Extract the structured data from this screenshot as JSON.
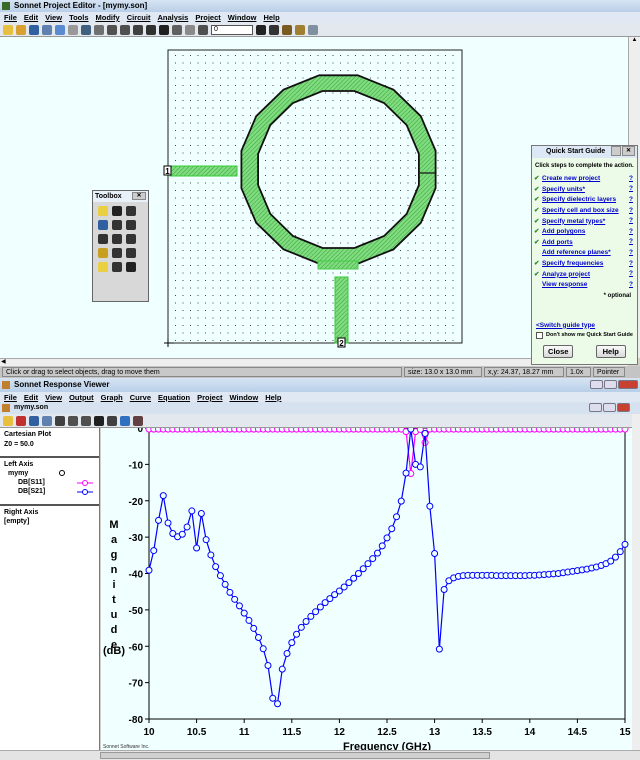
{
  "editor": {
    "title": "Sonnet Project Editor - [mymy.son]",
    "menu": [
      "File",
      "Edit",
      "View",
      "Tools",
      "Modify",
      "Circuit",
      "Analysis",
      "Project",
      "Window",
      "Help"
    ],
    "toolbar_icons": [
      "new-icon",
      "open-icon",
      "save-icon",
      "cut-icon",
      "copy-icon",
      "paste-icon",
      "rotate-icon",
      "box-icon",
      "zoom-in-icon",
      "zoom-out-icon",
      "zoom-fit-icon",
      "pan-icon",
      "center-icon",
      "eraser-icon",
      "layer-icon",
      "level-icon"
    ],
    "level_select": "0",
    "toolbar_icons2": [
      "split-icon",
      "add-port-icon",
      "ruler-icon",
      "analyze-icon",
      "print-icon"
    ],
    "port1_label": "1",
    "port2_label": "2",
    "status": {
      "message": "Click or drag to select objects, drag to move them",
      "size": "size: 13.0 x 13.0 mm",
      "xy": "x,y: 24.37, 18.27 mm",
      "zoom": "1.0x",
      "mode": "Pointer"
    },
    "colors": {
      "metal": "#7fdc7f",
      "metal_hatch": "#3aa03a",
      "outline": "#111111"
    }
  },
  "toolbox": {
    "title": "Toolbox",
    "icons": [
      "pointer-icon",
      "reshape-icon",
      "edge-icon",
      "via-icon",
      "dielectric-brick-icon",
      "draw-polygon-icon",
      "draw-circle-icon",
      "draw-round-icon",
      "add-text-icon",
      "add-rect-icon",
      "add-via-icon",
      "ref-plane-icon",
      "port-icon",
      "dim-icon",
      "component-icon"
    ]
  },
  "quick_start": {
    "title": "Quick Start Guide",
    "instruction": "Click steps to complete the action.",
    "steps": [
      {
        "label": "Create new project",
        "done": true
      },
      {
        "label": "Specify units*",
        "done": true
      },
      {
        "label": "Specify dielectric layers",
        "done": true
      },
      {
        "label": "Specify cell and box size",
        "done": true
      },
      {
        "label": "Specify metal types*",
        "done": true
      },
      {
        "label": "Add polygons",
        "done": true
      },
      {
        "label": "Add ports",
        "done": true
      },
      {
        "label": "Add reference planes*",
        "done": false
      },
      {
        "label": "Specify frequencies",
        "done": true
      },
      {
        "label": "Analyze project",
        "done": true
      },
      {
        "label": "View response",
        "done": false
      }
    ],
    "help_mark": "?",
    "optional_note": "* optional",
    "switch_link": "<Switch guide type",
    "dont_show": "Don't show me Quick Start Guide",
    "close": "Close",
    "help": "Help"
  },
  "viewer": {
    "title": "Sonnet Response Viewer",
    "menu": [
      "File",
      "Edit",
      "View",
      "Output",
      "Graph",
      "Curve",
      "Equation",
      "Project",
      "Window",
      "Help"
    ],
    "doc_title": "mymy.son",
    "toolbar_icons": [
      "open-icon",
      "print-preview-icon",
      "save-icon",
      "copy-icon",
      "box-icon",
      "zoom-in-icon",
      "zoom-out-icon",
      "pan-icon",
      "eraser-icon",
      "export-icon",
      "analyze-icon"
    ],
    "panel": {
      "plot_type": "Cartesian Plot",
      "z0": "Z0 = 50.0",
      "left_axis": "Left Axis",
      "project": "mymy",
      "right_axis": "Right Axis",
      "right_empty": "[empty]"
    },
    "footer": "Sonnet Software Inc."
  },
  "chart_data": {
    "type": "line",
    "title": "",
    "xlabel": "Frequency (GHz)",
    "ylabel_letters": [
      "M",
      "a",
      "g",
      "n",
      "i",
      "t",
      "u",
      "d",
      "e"
    ],
    "ylabel_unit": "(dB)",
    "xlim": [
      10,
      15
    ],
    "ylim": [
      -80,
      0
    ],
    "xticks": [
      "10",
      "10.5",
      "11",
      "11.5",
      "12",
      "12.5",
      "13",
      "13.5",
      "14",
      "14.5",
      "15"
    ],
    "yticks": [
      "0",
      "-10",
      "-20",
      "-30",
      "-40",
      "-50",
      "-60",
      "-70",
      "-80"
    ],
    "x_start": 10,
    "x_step": 0.05,
    "series": [
      {
        "name": "DB[S11]",
        "color": "#ff00ff",
        "values": [
          -0.3,
          -0.3,
          -0.3,
          -0.3,
          -0.3,
          -0.3,
          -0.3,
          -0.3,
          -0.3,
          -0.3,
          -0.3,
          -0.3,
          -0.3,
          -0.3,
          -0.3,
          -0.3,
          -0.3,
          -0.3,
          -0.3,
          -0.3,
          -0.3,
          -0.3,
          -0.3,
          -0.3,
          -0.3,
          -0.3,
          -0.3,
          -0.3,
          -0.3,
          -0.3,
          -0.3,
          -0.3,
          -0.3,
          -0.3,
          -0.3,
          -0.3,
          -0.3,
          -0.3,
          -0.3,
          -0.3,
          -0.3,
          -0.3,
          -0.3,
          -0.3,
          -0.3,
          -0.3,
          -0.3,
          -0.3,
          -0.3,
          -0.3,
          -0.3,
          -0.3,
          -0.3,
          -0.3,
          -1.0,
          -12.5,
          -1.0,
          -0.4,
          -4.0,
          -0.3,
          -0.3,
          -0.3,
          -0.3,
          -0.3,
          -0.3,
          -0.3,
          -0.3,
          -0.3,
          -0.3,
          -0.3,
          -0.3,
          -0.3,
          -0.3,
          -0.3,
          -0.3,
          -0.3,
          -0.3,
          -0.3,
          -0.3,
          -0.3,
          -0.3,
          -0.3,
          -0.3,
          -0.3,
          -0.3,
          -0.3,
          -0.3,
          -0.3,
          -0.3,
          -0.3,
          -0.3,
          -0.3,
          -0.3,
          -0.3,
          -0.3,
          -0.3,
          -0.3,
          -0.3,
          -0.3,
          -0.3,
          -0.3
        ]
      },
      {
        "name": "DB[S21]",
        "color": "#0000ff",
        "values": [
          -39.1,
          -33.7,
          -25.4,
          -18.6,
          -26.1,
          -29.0,
          -29.9,
          -29.2,
          -27.2,
          -22.8,
          -33.0,
          -23.5,
          -30.7,
          -34.9,
          -38.1,
          -40.6,
          -43.0,
          -45.2,
          -47.1,
          -48.9,
          -50.9,
          -52.9,
          -55.1,
          -57.6,
          -60.7,
          -65.3,
          -74.3,
          -75.8,
          -66.3,
          -62.0,
          -59.0,
          -56.7,
          -54.8,
          -53.2,
          -51.8,
          -50.5,
          -49.2,
          -48.0,
          -46.9,
          -45.8,
          -44.8,
          -43.7,
          -42.5,
          -41.3,
          -40.0,
          -38.7,
          -37.3,
          -35.9,
          -34.4,
          -32.4,
          -30.2,
          -27.7,
          -24.4,
          -20.1,
          -12.4,
          -0.3,
          -10.0,
          -10.7,
          -1.5,
          -21.5,
          -34.5,
          -60.8,
          -44.4,
          -42.0,
          -41.2,
          -40.8,
          -40.6,
          -40.5,
          -40.5,
          -40.5,
          -40.5,
          -40.5,
          -40.5,
          -40.6,
          -40.6,
          -40.6,
          -40.6,
          -40.6,
          -40.6,
          -40.6,
          -40.5,
          -40.5,
          -40.4,
          -40.3,
          -40.2,
          -40.1,
          -40.0,
          -39.8,
          -39.6,
          -39.4,
          -39.2,
          -39.0,
          -38.8,
          -38.5,
          -38.2,
          -37.8,
          -37.3,
          -36.6,
          -35.5,
          -34.0,
          -32.0
        ]
      }
    ],
    "grid": false,
    "legend": "left-panel"
  }
}
